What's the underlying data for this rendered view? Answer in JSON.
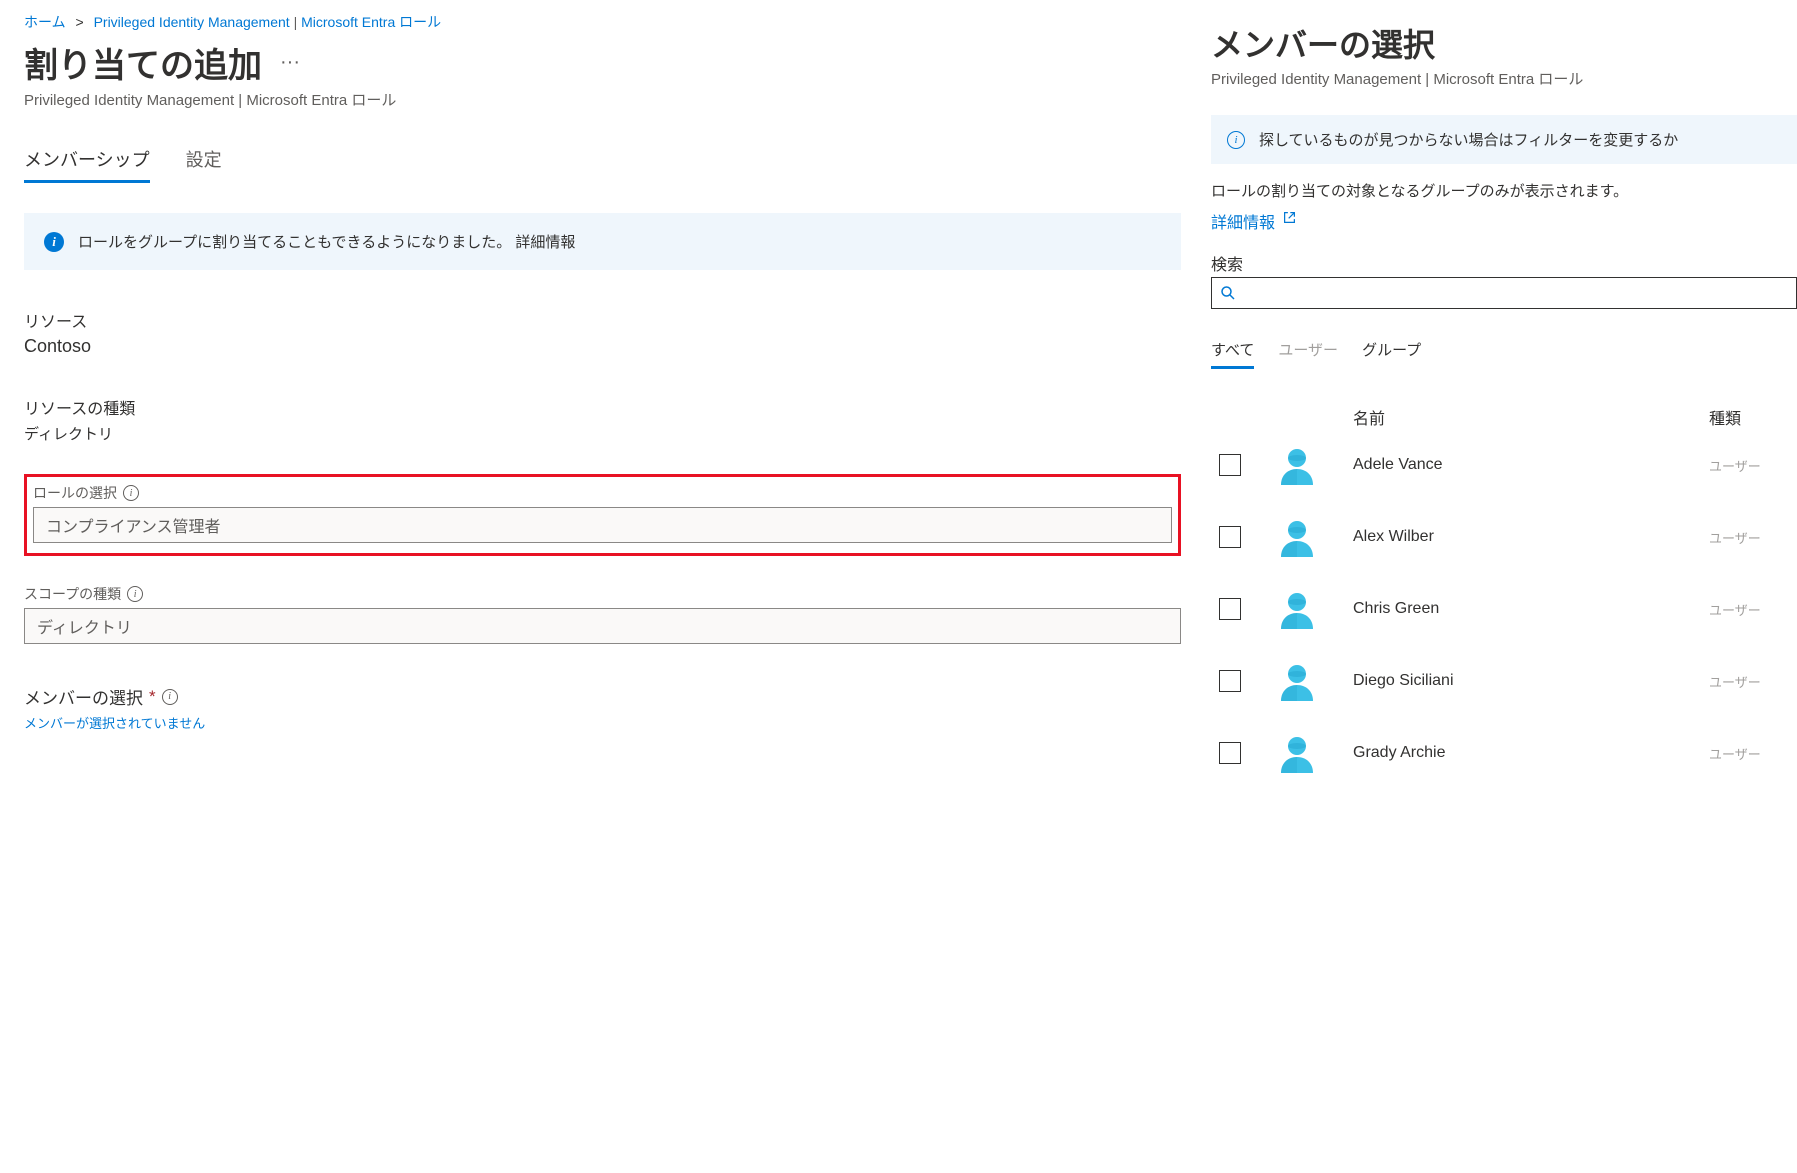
{
  "breadcrumb": {
    "home": "ホーム",
    "pim": "Privileged Identity Management",
    "roles": "Microsoft  Entra ロール"
  },
  "page": {
    "title": "割り当ての追加",
    "subtitle": "Privileged Identity Management | Microsoft  Entra ロール"
  },
  "tabs": {
    "membership": "メンバーシップ",
    "settings": "設定"
  },
  "banner": {
    "text": "ロールをグループに割り当てることもできるようになりました。 詳細情報"
  },
  "resource": {
    "label": "リソース",
    "value": "Contoso"
  },
  "resource_type": {
    "label": "リソースの種類",
    "value": "ディレクトリ"
  },
  "role_select": {
    "label": "ロールの選択",
    "value": "コンプライアンス管理者"
  },
  "scope_type": {
    "label": "スコープの種類",
    "value": "ディレクトリ"
  },
  "member_select": {
    "label": "メンバーの選択",
    "none": "メンバーが選択されていません"
  },
  "panel": {
    "title": "メンバーの選択",
    "subtitle": "Privileged Identity Management |  Microsoft Entra ロール",
    "info": "探しているものが見つからない場合はフィルターを変更するか",
    "desc": "ロールの割り当ての対象となるグループのみが表示されます。",
    "detail_link": "詳細情報",
    "search_label": "検索"
  },
  "panel_tabs": {
    "all": "すべて",
    "users": "ユーザー",
    "groups": "グループ"
  },
  "columns": {
    "name": "名前",
    "type": "種類"
  },
  "members": [
    {
      "name": "Adele Vance",
      "type": "ユーザー"
    },
    {
      "name": "Alex Wilber",
      "type": "ユーザー"
    },
    {
      "name": "Chris Green",
      "type": "ユーザー"
    },
    {
      "name": "Diego Siciliani",
      "type": "ユーザー"
    },
    {
      "name": "Grady Archie",
      "type": "ユーザー"
    }
  ]
}
